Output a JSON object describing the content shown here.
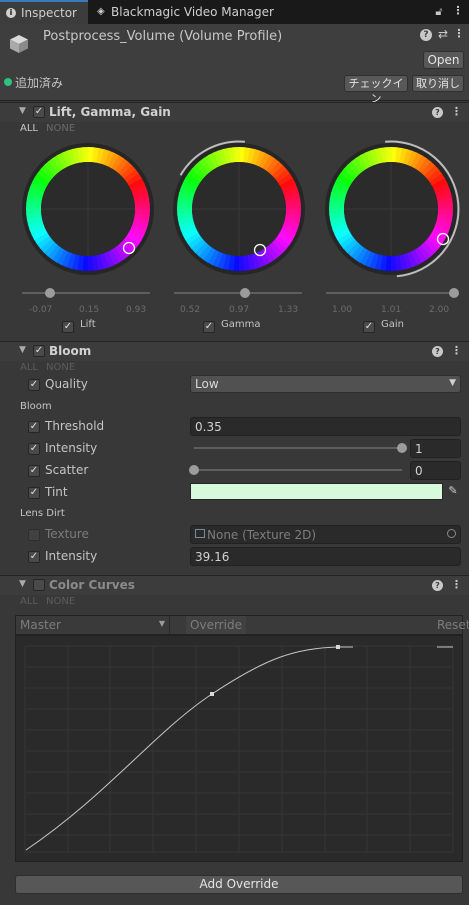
{
  "tabs": {
    "inspector": "Inspector",
    "bvm": "Blackmagic Video Manager"
  },
  "header": {
    "title": "Postprocess_Volume (Volume Profile)",
    "open_label": "Open",
    "added_label": "追加済み",
    "checkin_label": "チェックイン",
    "revert_label": "取り消し"
  },
  "lgg": {
    "title": "Lift, Gamma, Gain",
    "all_label": "ALL",
    "none_label": "NONE",
    "wheels": [
      {
        "name": "Lift",
        "min": "-0.07",
        "mid": "0.15",
        "max": "0.93",
        "value": 0.15,
        "range": [
          -0.07,
          0.93
        ]
      },
      {
        "name": "Gamma",
        "min": "0.52",
        "mid": "0.97",
        "max": "1.33",
        "value": 0.97,
        "range": [
          0.52,
          1.33
        ]
      },
      {
        "name": "Gain",
        "min": "1.00",
        "mid": "1.01",
        "max": "2.00",
        "value": 2.0,
        "range": [
          1.0,
          2.0
        ]
      }
    ]
  },
  "bloom": {
    "title": "Bloom",
    "all_label": "ALL",
    "none_label": "NONE",
    "quality_label": "Quality",
    "quality_value": "Low",
    "group_bloom": "Bloom",
    "threshold_label": "Threshold",
    "threshold_value": "0.35",
    "intensity_label": "Intensity",
    "intensity_value": "1",
    "intensity_level": 1.0,
    "scatter_label": "Scatter",
    "scatter_value": "0",
    "scatter_level": 0.0,
    "tint_label": "Tint",
    "tint_color": "#d8fadc",
    "group_lens": "Lens Dirt",
    "texture_label": "Texture",
    "texture_value": "None (Texture 2D)",
    "dirt_intensity_label": "Intensity",
    "dirt_intensity_value": "39.16"
  },
  "curves": {
    "title": "Color Curves",
    "all_label": "ALL",
    "none_label": "NONE",
    "channel": "Master",
    "override_label": "Override",
    "reset_label": "Reset"
  },
  "footer": {
    "add_override_label": "Add Override"
  }
}
